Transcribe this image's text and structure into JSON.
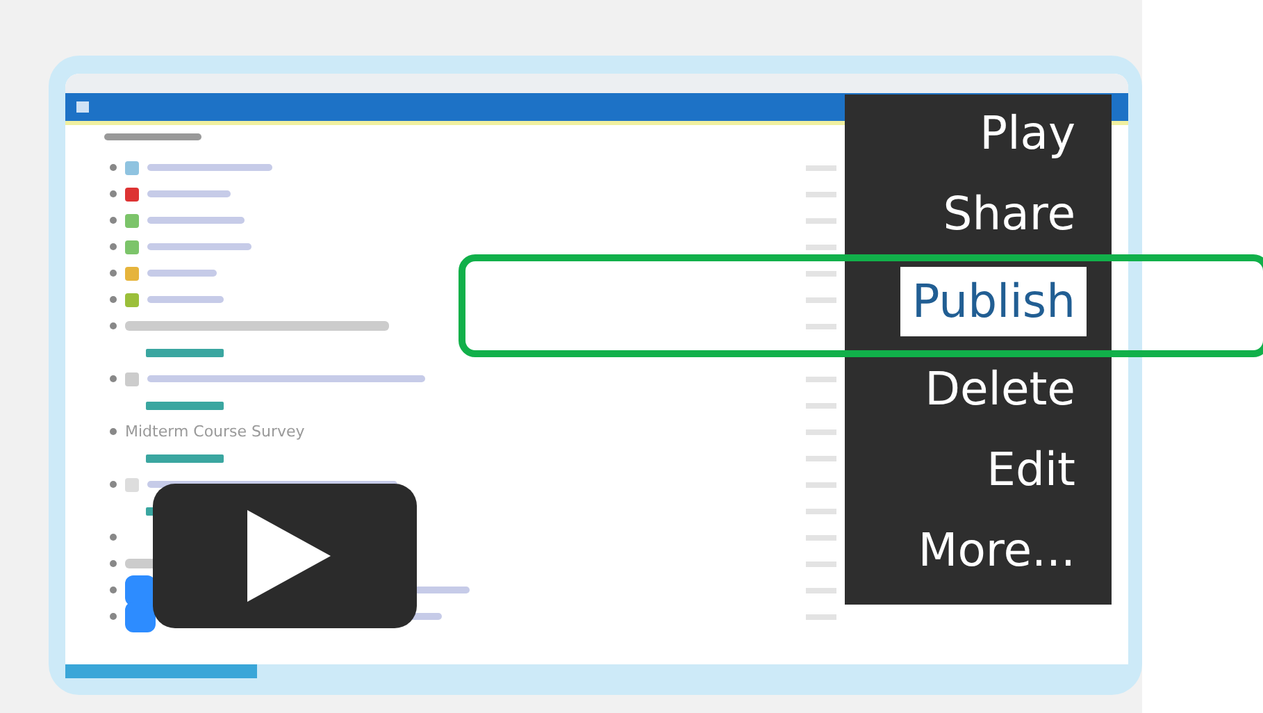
{
  "course_page": {
    "section_title": "Midterm Course Survey"
  },
  "menu": {
    "items": [
      {
        "label": "Play",
        "selected": false
      },
      {
        "label": "Share",
        "selected": false
      },
      {
        "label": "Publish",
        "selected": true
      },
      {
        "label": "Delete",
        "selected": false
      },
      {
        "label": "Edit",
        "selected": false
      },
      {
        "label": "More...",
        "selected": false
      }
    ]
  },
  "video": {
    "progress": {
      "level": 0.18
    }
  }
}
